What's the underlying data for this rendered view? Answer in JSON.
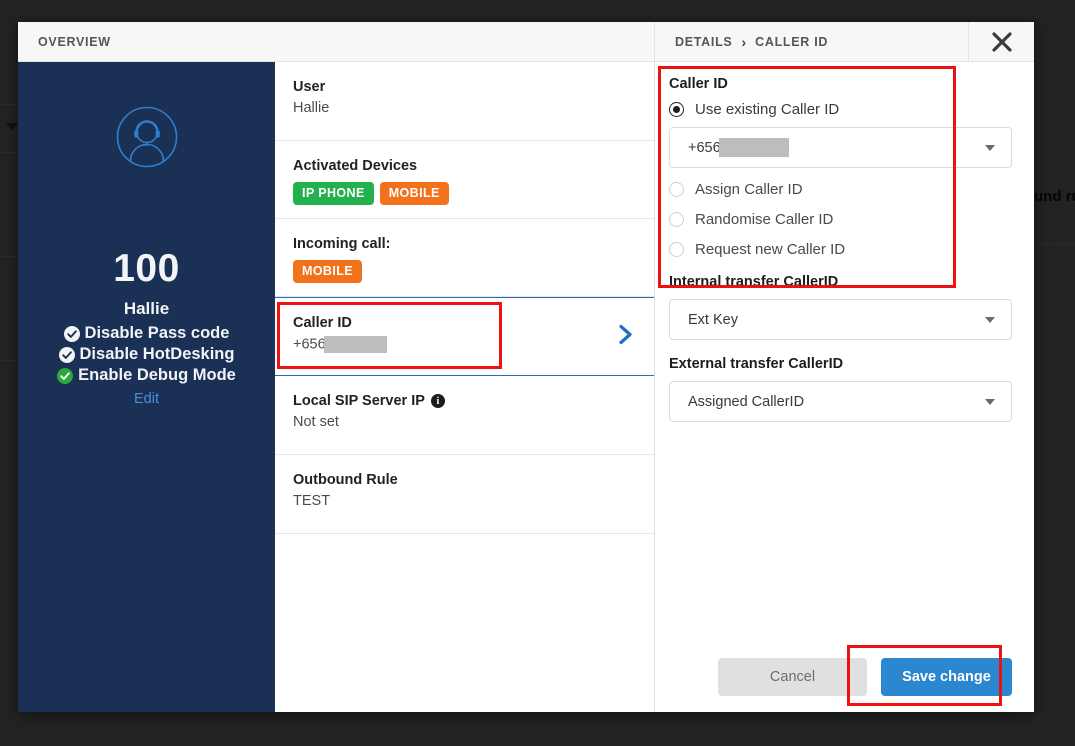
{
  "backdrop": {
    "partial_text": "und ru"
  },
  "header": {
    "overview_tab": "OVERVIEW",
    "breadcrumb": {
      "root": "DETAILS",
      "separator": "›",
      "current": "CALLER ID"
    },
    "close_icon": "close-icon"
  },
  "sidebar": {
    "avatar_icon": "agent-headset-avatar-icon",
    "extension": "100",
    "name": "Hallie",
    "flags": [
      {
        "label": "Disable Pass code",
        "state_color": "#f2f4f7"
      },
      {
        "label": "Disable HotDesking",
        "state_color": "#f2f4f7"
      },
      {
        "label": "Enable Debug Mode",
        "state_color": "#2aaa3a"
      }
    ],
    "edit_link": "Edit"
  },
  "details_list": [
    {
      "label": "User",
      "value": "Hallie"
    },
    {
      "label": "Activated Devices",
      "badges": [
        {
          "text": "IP PHONE",
          "color": "#22b14c"
        },
        {
          "text": "MOBILE",
          "color": "#f2711c"
        }
      ]
    },
    {
      "label": "Incoming call:",
      "badges": [
        {
          "text": "MOBILE",
          "color": "#f2711c"
        }
      ]
    },
    {
      "label": "Caller ID",
      "value": "+656",
      "redacted": true,
      "selected": true
    },
    {
      "label": "Local SIP Server IP",
      "value": "Not set",
      "info_icon": true
    },
    {
      "label": "Outbound Rule",
      "value": "TEST"
    }
  ],
  "caller_id_panel": {
    "group_title": "Caller ID",
    "options": [
      {
        "label": "Use existing Caller ID",
        "selected": true
      },
      {
        "label": "Assign Caller ID",
        "selected": false
      },
      {
        "label": "Randomise Caller ID",
        "selected": false
      },
      {
        "label": "Request new Caller ID",
        "selected": false
      }
    ],
    "existing_number": "+656",
    "existing_number_redacted": true,
    "internal_transfer": {
      "label": "Internal transfer CallerID",
      "value": "Ext Key"
    },
    "external_transfer": {
      "label": "External transfer CallerID",
      "value": "Assigned CallerID"
    }
  },
  "footer": {
    "cancel_label": "Cancel",
    "save_label": "Save change"
  },
  "colors": {
    "sidebar_bg": "#1b3055",
    "accent_blue": "#2b87cf",
    "annotation_red": "#ee1111",
    "badge_green": "#22b14c",
    "badge_orange": "#f2711c"
  }
}
